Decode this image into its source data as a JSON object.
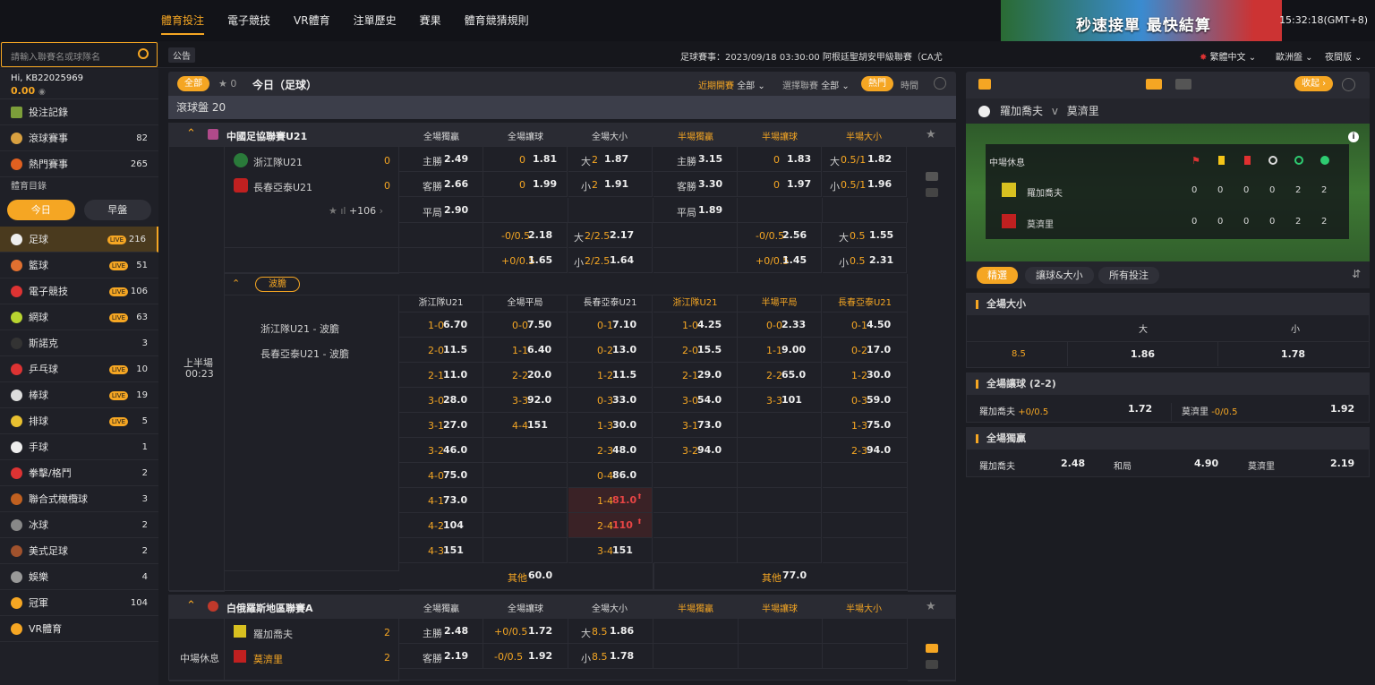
{
  "topnav": [
    "體育投注",
    "電子競技",
    "VR體育",
    "注單歷史",
    "賽果",
    "體育競猜規則"
  ],
  "banner": {
    "text": "秒速接單 最快結算"
  },
  "clock": "15:32:18(GMT+8)",
  "search": {
    "placeholder": "請輸入聯賽名或球隊名"
  },
  "announce": "公告",
  "ticker": "足球賽事：2023/09/18 03:30:00 阿根廷聖胡安甲級聯賽（CA尤",
  "lang": {
    "language": "繁體中文",
    "odds": "歐洲盤",
    "theme": "夜間版"
  },
  "user": {
    "hi": "Hi, KB22025969",
    "balance": "0.00"
  },
  "sidebar": {
    "bets": "投注記錄",
    "live": {
      "label": "滾球賽事",
      "count": "82"
    },
    "hot": {
      "label": "熱門賽事",
      "count": "265"
    },
    "catalog": "體育目錄",
    "today": "今日",
    "early": "早盤",
    "sports": [
      {
        "name": "足球",
        "live": "LIVE",
        "count": "216",
        "color": "#eee"
      },
      {
        "name": "籃球",
        "live": "LIVE",
        "count": "51",
        "color": "#e07030"
      },
      {
        "name": "電子競技",
        "live": "LIVE",
        "count": "106",
        "color": "#d33"
      },
      {
        "name": "網球",
        "live": "LIVE",
        "count": "63",
        "color": "#b8d430"
      },
      {
        "name": "斯諾克",
        "live": "",
        "count": "3",
        "color": "#333"
      },
      {
        "name": "乒乓球",
        "live": "LIVE",
        "count": "10",
        "color": "#d33"
      },
      {
        "name": "棒球",
        "live": "LIVE",
        "count": "19",
        "color": "#ddd"
      },
      {
        "name": "排球",
        "live": "LIVE",
        "count": "5",
        "color": "#e8c030"
      },
      {
        "name": "手球",
        "live": "",
        "count": "1",
        "color": "#eee"
      },
      {
        "name": "拳擊/格鬥",
        "live": "",
        "count": "2",
        "color": "#d33"
      },
      {
        "name": "聯合式橄欖球",
        "live": "",
        "count": "3",
        "color": "#c06020"
      },
      {
        "name": "冰球",
        "live": "",
        "count": "2",
        "color": "#888"
      },
      {
        "name": "美式足球",
        "live": "",
        "count": "2",
        "color": "#a0522d"
      },
      {
        "name": "娛樂",
        "live": "",
        "count": "4",
        "color": "#999"
      },
      {
        "name": "冠軍",
        "live": "",
        "count": "104",
        "color": "#f5a623"
      },
      {
        "name": "VR體育",
        "live": "",
        "count": "",
        "color": "#f5a623"
      }
    ]
  },
  "main": {
    "all": "全部",
    "fav_count": "0",
    "title": "今日（足球）",
    "recent": "近期開賽",
    "recent_val": "全部",
    "choose": "選擇聯賽",
    "choose_val": "全部",
    "hot": "熱門",
    "time": "時間",
    "inplay": "滾球盤  20",
    "cols": [
      "全場獨贏",
      "全場讓球",
      "全場大小",
      "半場獨贏",
      "半場讓球",
      "半場大小"
    ],
    "l1": {
      "name": "中國足協聯賽U21",
      "status": "上半場",
      "minute": "00:23",
      "home": "浙江隊U21",
      "away": "長春亞泰U21",
      "hs": "0",
      "as": "0",
      "more": "+106",
      "r1": [
        "主勝",
        "2.49",
        "0",
        "1.81",
        "大",
        "2",
        "1.87",
        "主勝",
        "3.15",
        "0",
        "1.83",
        "大",
        "0.5/1",
        "1.82"
      ],
      "r2": [
        "客勝",
        "2.66",
        "0",
        "1.99",
        "小",
        "2",
        "1.91",
        "客勝",
        "3.30",
        "0",
        "1.97",
        "小",
        "0.5/1",
        "1.96"
      ],
      "r3": [
        "平局",
        "2.90",
        "平局",
        "1.89"
      ],
      "r4": [
        "-0/0.5",
        "2.18",
        "大",
        "2/2.5",
        "2.17",
        "-0/0.5",
        "2.56",
        "大",
        "0.5",
        "1.55"
      ],
      "r5": [
        "+0/0.5",
        "1.65",
        "小",
        "2/2.5",
        "1.64",
        "+0/0.5",
        "1.45",
        "小",
        "0.5",
        "2.31"
      ],
      "cs_tab": "波膽",
      "cs_cols": [
        "浙江隊U21",
        "全場平局",
        "長春亞泰U21",
        "浙江隊U21",
        "半場平局",
        "長春亞泰U21"
      ],
      "cs_labels": [
        "浙江隊U21 - 波膽",
        "長春亞泰U21 - 波膽"
      ],
      "cs_rows": [
        [
          "1-0",
          "6.70",
          "0-0",
          "7.50",
          "0-1",
          "7.10",
          "1-0",
          "4.25",
          "0-0",
          "2.33",
          "0-1",
          "4.50"
        ],
        [
          "2-0",
          "11.5",
          "1-1",
          "6.40",
          "0-2",
          "13.0",
          "2-0",
          "15.5",
          "1-1",
          "9.00",
          "0-2",
          "17.0"
        ],
        [
          "2-1",
          "11.0",
          "2-2",
          "20.0",
          "1-2",
          "11.5",
          "2-1",
          "29.0",
          "2-2",
          "65.0",
          "1-2",
          "30.0"
        ],
        [
          "3-0",
          "28.0",
          "3-3",
          "92.0",
          "0-3",
          "33.0",
          "3-0",
          "54.0",
          "3-3",
          "101",
          "0-3",
          "59.0"
        ],
        [
          "3-1",
          "27.0",
          "4-4",
          "151",
          "1-3",
          "30.0",
          "3-1",
          "73.0",
          "",
          "",
          "1-3",
          "75.0"
        ],
        [
          "3-2",
          "46.0",
          "",
          "",
          "2-3",
          "48.0",
          "3-2",
          "94.0",
          "",
          "",
          "2-3",
          "94.0"
        ],
        [
          "4-0",
          "75.0",
          "",
          "",
          "0-4",
          "86.0",
          "",
          "",
          "",
          "",
          "",
          ""
        ],
        [
          "4-1",
          "73.0",
          "",
          "",
          "1-4",
          "81.0",
          "",
          "",
          "",
          "",
          "",
          ""
        ],
        [
          "4-2",
          "104",
          "",
          "",
          "2-4",
          "110",
          "",
          "",
          "",
          "",
          "",
          ""
        ],
        [
          "4-3",
          "151",
          "",
          "",
          "3-4",
          "151",
          "",
          "",
          "",
          "",
          "",
          ""
        ]
      ],
      "other_label": "其他",
      "other_full": "60.0",
      "other_half": "77.0"
    },
    "l2": {
      "name": "白俄羅斯地區聯賽A",
      "status": "中場休息",
      "home": "羅加喬夫",
      "away": "莫濟里",
      "hs": "2",
      "as": "2",
      "r1": [
        "主勝",
        "2.48",
        "+0/0.5",
        "1.72",
        "大",
        "8.5",
        "1.86"
      ],
      "r2": [
        "客勝",
        "2.19",
        "-0/0.5",
        "1.92",
        "小",
        "8.5",
        "1.78"
      ]
    }
  },
  "right": {
    "collapse": "收起",
    "home": "羅加喬夫",
    "v": "v",
    "away": "莫濟里",
    "half": "中場休息",
    "home_stats": [
      "0",
      "0",
      "0",
      "0",
      "2",
      "2"
    ],
    "away_stats": [
      "0",
      "0",
      "0",
      "0",
      "2",
      "2"
    ],
    "tabs": [
      "精選",
      "讓球&大小",
      "所有投注"
    ],
    "m1": {
      "title": "全場大小",
      "over": "大",
      "under": "小",
      "line": "8.5",
      "o": "1.86",
      "u": "1.78"
    },
    "m2": {
      "title": "全場讓球 (2-2)",
      "home": "羅加喬夫",
      "hh": "+0/0.5",
      "ho": "1.72",
      "away": "莫濟里",
      "ah": "-0/0.5",
      "ao": "1.92"
    },
    "m3": {
      "title": "全場獨贏",
      "home": "羅加喬夫",
      "ho": "2.48",
      "draw": "和局",
      "do": "4.90",
      "away": "莫濟里",
      "ao": "2.19"
    }
  }
}
